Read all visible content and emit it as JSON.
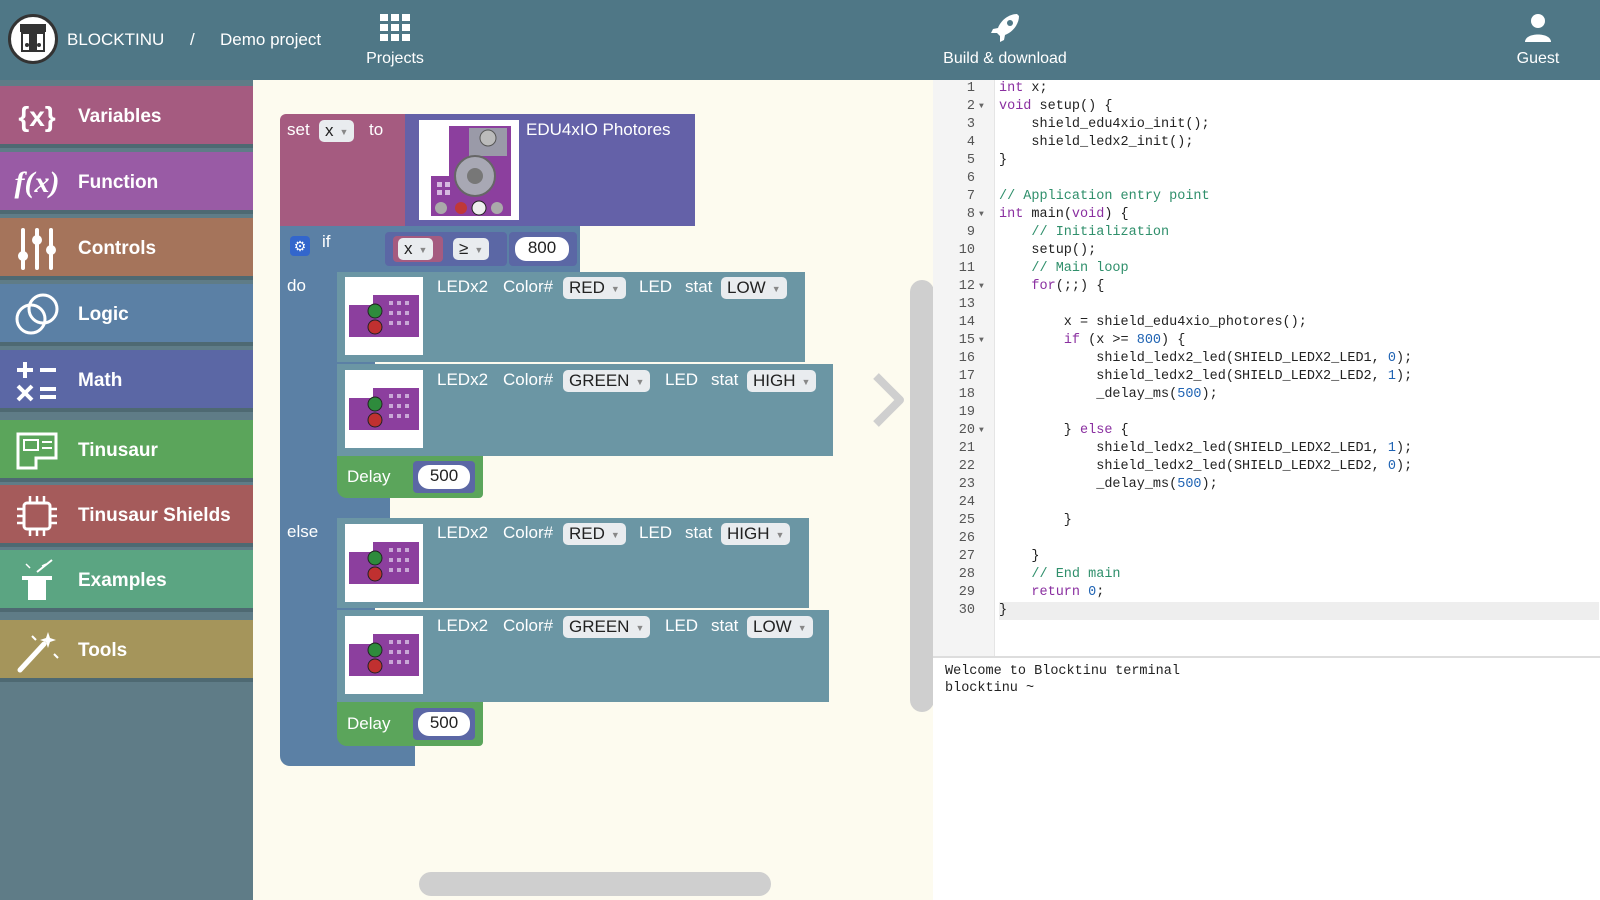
{
  "header": {
    "brand": "BLOCKTINU",
    "separator": "/",
    "project": "Demo project",
    "projects_label": "Projects",
    "build_label": "Build & download",
    "guest_label": "Guest",
    "color": "#4f7786"
  },
  "sidebar": {
    "items": [
      {
        "label": "Variables",
        "icon": "{x}",
        "color": "#a55b80"
      },
      {
        "label": "Function",
        "icon": "f(x)",
        "color": "#995ba5"
      },
      {
        "label": "Controls",
        "icon": "sliders-icon",
        "color": "#a5745b"
      },
      {
        "label": "Logic",
        "icon": "venn-icon",
        "color": "#5b80a5"
      },
      {
        "label": "Math",
        "icon": "math-icon",
        "color": "#5b67a5"
      },
      {
        "label": "Tinusaur",
        "icon": "board-icon",
        "color": "#5ba55b"
      },
      {
        "label": "Tinusaur Shields",
        "icon": "chip-icon",
        "color": "#a55b5b"
      },
      {
        "label": "Examples",
        "icon": "magic-hat-icon",
        "color": "#5ba582"
      },
      {
        "label": "Tools",
        "icon": "magic-wand-icon",
        "color": "#a5955b"
      }
    ]
  },
  "blocks": {
    "set_label": "set",
    "set_var": "x",
    "to_label": "to",
    "sensor_label": "EDU4xIO Photores",
    "if_label": "if",
    "cond_var": "x",
    "cond_op": "≥",
    "cond_value": "800",
    "do_label": "do",
    "else_label": "else",
    "led_label": "LEDx2",
    "color_label": "Color#",
    "led_word": "LED",
    "stat_label": "stat",
    "do_led1_color": "RED",
    "do_led1_stat": "LOW",
    "do_led2_color": "GREEN",
    "do_led2_stat": "HIGH",
    "do_delay_label": "Delay",
    "do_delay_value": "500",
    "else_led1_color": "RED",
    "else_led1_stat": "HIGH",
    "else_led2_color": "GREEN",
    "else_led2_stat": "LOW",
    "else_delay_label": "Delay",
    "else_delay_value": "500"
  },
  "code": {
    "lines": [
      "int x;",
      "void setup() {",
      "    shield_edu4xio_init();",
      "    shield_ledx2_init();",
      "}",
      "",
      "// Application entry point",
      "int main(void) {",
      "    // Initialization",
      "    setup();",
      "    // Main loop",
      "    for(;;) {",
      "",
      "        x = shield_edu4xio_photores();",
      "        if (x >= 800) {",
      "            shield_ledx2_led(SHIELD_LEDX2_LED1, 0);",
      "            shield_ledx2_led(SHIELD_LEDX2_LED2, 1);",
      "            _delay_ms(500);",
      "",
      "        } else {",
      "            shield_ledx2_led(SHIELD_LEDX2_LED1, 1);",
      "            shield_ledx2_led(SHIELD_LEDX2_LED2, 0);",
      "            _delay_ms(500);",
      "",
      "        }",
      "",
      "    }",
      "    // End main",
      "    return 0;",
      "}"
    ],
    "fold_lines": [
      2,
      8,
      12,
      15,
      20
    ]
  },
  "terminal": {
    "line1": "Welcome to Blocktinu terminal",
    "line2": "blocktinu ~"
  }
}
